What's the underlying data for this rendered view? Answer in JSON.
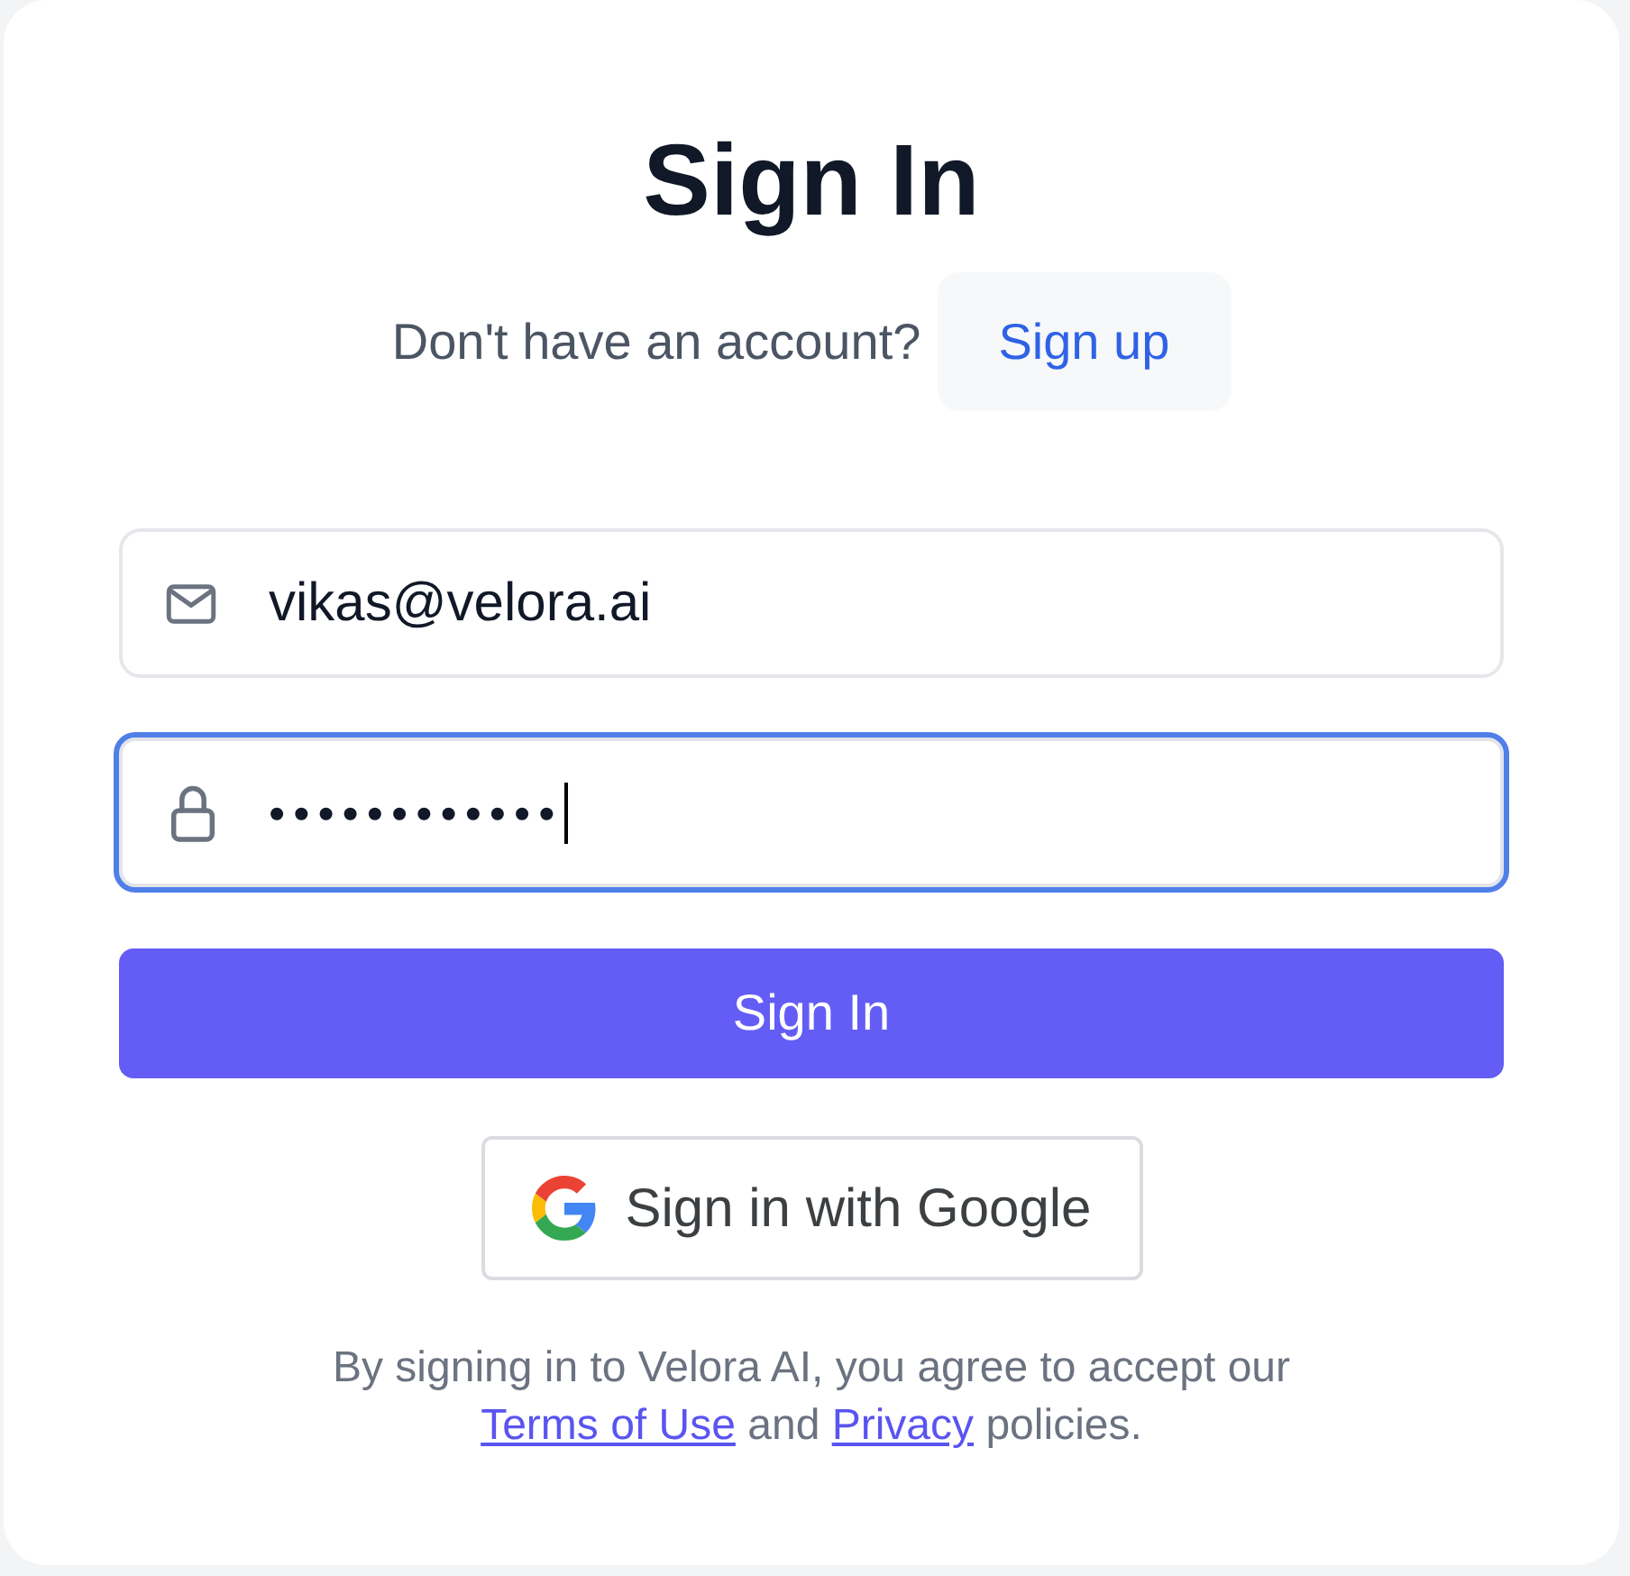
{
  "title": "Sign In",
  "signup_prompt": {
    "text": "Don't have an account?",
    "button": "Sign up"
  },
  "fields": [
    {
      "kind": "email",
      "value": "vikas@velora.ai",
      "focused": false
    },
    {
      "kind": "password",
      "value": "••••••••••••",
      "focused": true
    }
  ],
  "submit_button": "Sign In",
  "google_button": "Sign in with Google",
  "legal": [
    {
      "kind": "text",
      "text": "By signing in to Velora AI, you agree to accept our"
    },
    {
      "kind": "link",
      "text": "Terms of Use"
    },
    {
      "kind": "text",
      "text": "and"
    },
    {
      "kind": "link",
      "text": "Privacy"
    },
    {
      "kind": "text",
      "text": "policies."
    }
  ]
}
